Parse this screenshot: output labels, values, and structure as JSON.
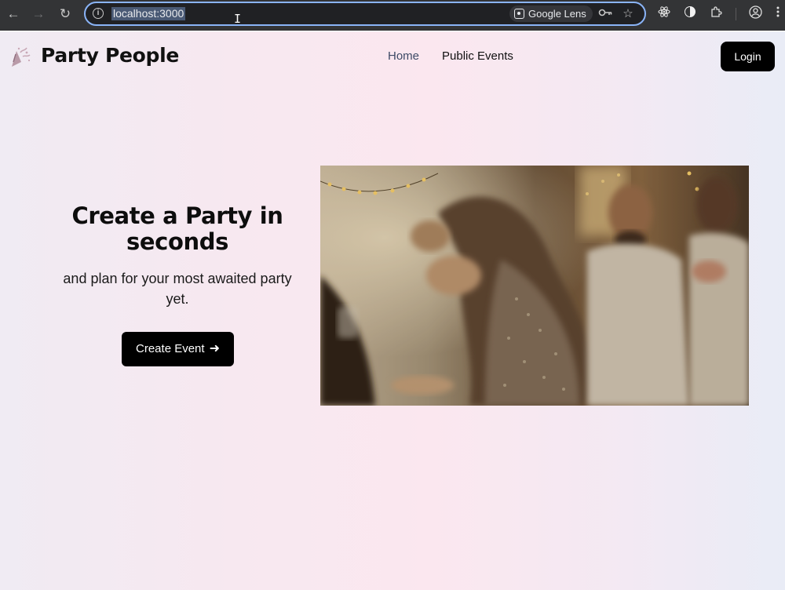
{
  "browser": {
    "url": "localhost:3000",
    "lens_label": "Google Lens",
    "icons": [
      "back-arrow-icon",
      "forward-arrow-icon",
      "reload-icon",
      "info-icon",
      "google-lens-icon",
      "password-key-icon",
      "bookmark-star-icon",
      "react-devtools-icon",
      "extension-circle-icon",
      "extensions-puzzle-icon",
      "profile-icon",
      "menu-kebab-icon"
    ]
  },
  "header": {
    "brand": "Party People",
    "nav": [
      {
        "label": "Home",
        "active": true
      },
      {
        "label": "Public Events",
        "active": false
      }
    ],
    "login_label": "Login"
  },
  "hero": {
    "title": "Create a Party in seconds",
    "subtitle": "and plan for your most awaited party yet.",
    "cta_label": "Create Event",
    "cta_icon": "arrow-right-icon",
    "image_description": "party-photo"
  },
  "colors": {
    "accent_focus": "#8ab4f8",
    "button_bg": "#000000",
    "active_nav": "#3d4a66"
  }
}
